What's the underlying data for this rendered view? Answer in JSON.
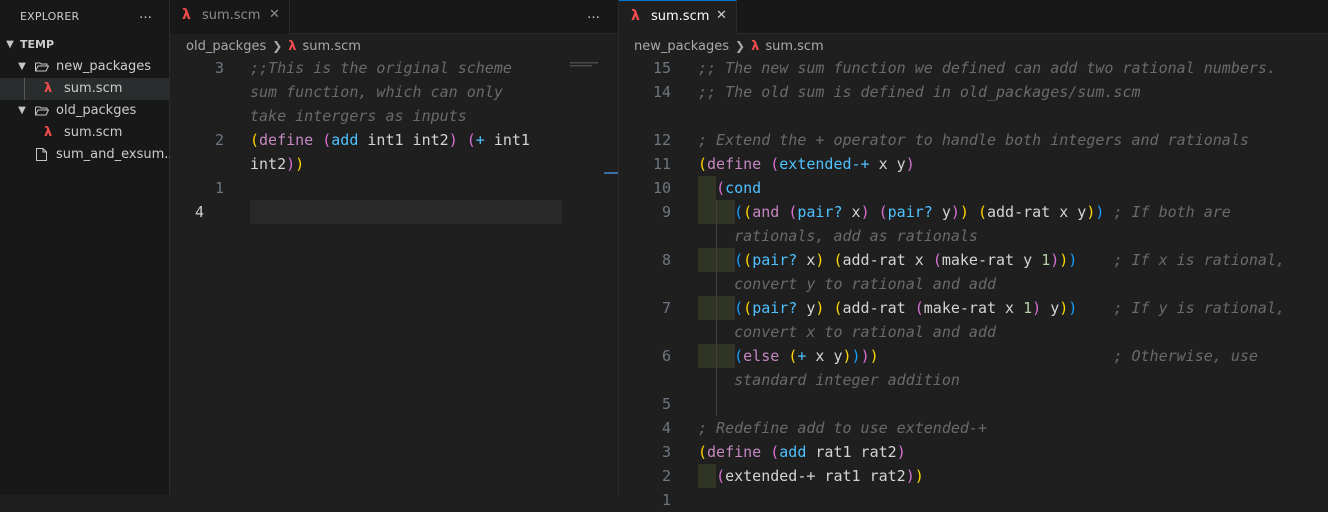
{
  "explorer": {
    "title": "EXPLORER",
    "more_icon": "…",
    "tree": [
      {
        "label": "TEMP",
        "type": "root",
        "expanded": true
      },
      {
        "label": "new_packages",
        "type": "folder",
        "expanded": true
      },
      {
        "label": "sum.scm",
        "type": "file-scheme",
        "selected": true
      },
      {
        "label": "old_packges",
        "type": "folder",
        "expanded": true
      },
      {
        "label": "sum.scm",
        "type": "file-scheme"
      },
      {
        "label": "sum_and_exsum...",
        "type": "file"
      }
    ]
  },
  "pane1": {
    "tab": {
      "label": "sum.scm",
      "icon": "lambda-icon"
    },
    "more_icon": "…",
    "breadcrumb": {
      "folder": "old_packges",
      "file": "sum.scm"
    },
    "gutter": [
      "3",
      "",
      "",
      "2",
      "",
      "1",
      "4"
    ],
    "lines": [
      ";;This is the original scheme",
      "sum function, which can only",
      "take intergers as inputs",
      "(define (add int1 int2) (+ int1",
      "int2))",
      "",
      ""
    ]
  },
  "pane2": {
    "tab": {
      "label": "sum.scm",
      "icon": "lambda-icon"
    },
    "breadcrumb": {
      "folder": "new_packages",
      "file": "sum.scm"
    },
    "gutter": [
      "15",
      "14",
      "",
      "12",
      "11",
      "10",
      "9",
      "",
      "8",
      "",
      "7",
      "",
      "6",
      "",
      "5",
      "4",
      "3",
      "2",
      "1"
    ],
    "lines": [
      ";; The new sum function we defined can add two rational numbers.",
      ";; The old sum is defined in old_packages/sum.scm",
      "",
      "; Extend the + operator to handle both integers and rationals",
      "(define (extended-+ x y)",
      "  (cond",
      "    ((and (pair? x) (pair? y)) (add-rat x y)) ; If both are",
      "    rationals, add as rationals",
      "    ((pair? x) (add-rat x (make-rat y 1)))    ; If x is rational,",
      "    convert y to rational and add",
      "    ((pair? y) (add-rat (make-rat x 1) y))    ; If y is rational,",
      "    convert x to rational and add",
      "    (else (+ x y))))                          ; Otherwise, use",
      "    standard integer addition",
      "",
      "; Redefine add to use extended-+",
      "(define (add rat1 rat2)",
      "  (extended-+ rat1 rat2))",
      ""
    ]
  },
  "colors": {
    "background": "#1f1f1f",
    "sidebar": "#181818",
    "comment": "#6a6a6a",
    "keyword": "#c586c0",
    "function": "#4fc1ff",
    "bracket_1": "#ffd700",
    "bracket_2": "#da70d6",
    "bracket_3": "#179fff",
    "scheme_icon": "#f14c4c",
    "focus_border": "#0078d4"
  }
}
